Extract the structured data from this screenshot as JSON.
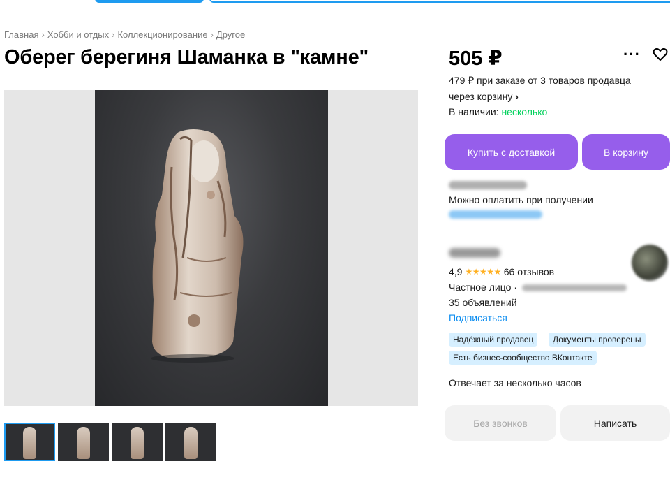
{
  "breadcrumb": [
    "Главная",
    "Хобби и отдых",
    "Коллекционирование",
    "Другое"
  ],
  "listing": {
    "title": "Оберег берегиня Шаманка в \"камне\"",
    "price": "505 ₽",
    "bulk_price": "479 ₽ при заказе от 3 товаров продавца через корзину",
    "bulk_arrow": "›",
    "availability_label": "В наличии:",
    "availability_value": "несколько"
  },
  "actions": {
    "buy_label": "Купить с доставкой",
    "cart_label": "В корзину",
    "more_icon": "more-dots-icon",
    "favorite_icon": "heart-icon"
  },
  "delivery": {
    "pay_note": "Можно оплатить при получении"
  },
  "seller": {
    "rating": "4,9",
    "stars": "★★★★★",
    "reviews": "66 отзывов",
    "type": "Частное лицо ·",
    "ads_count": "35 объявлений",
    "subscribe": "Подписаться",
    "badges": [
      "Надёжный продавец",
      "Документы проверены",
      "Есть бизнес-сообщество ВКонтакте"
    ],
    "response_time": "Отвечает за несколько часов"
  },
  "contact": {
    "call_label": "Без звонков",
    "write_label": "Написать"
  },
  "colors": {
    "accent_purple": "#965eeb",
    "link_blue": "#0a8cf0",
    "stock_green": "#02d15c",
    "badge_bg": "#d6efff",
    "star_yellow": "#ffb021"
  }
}
